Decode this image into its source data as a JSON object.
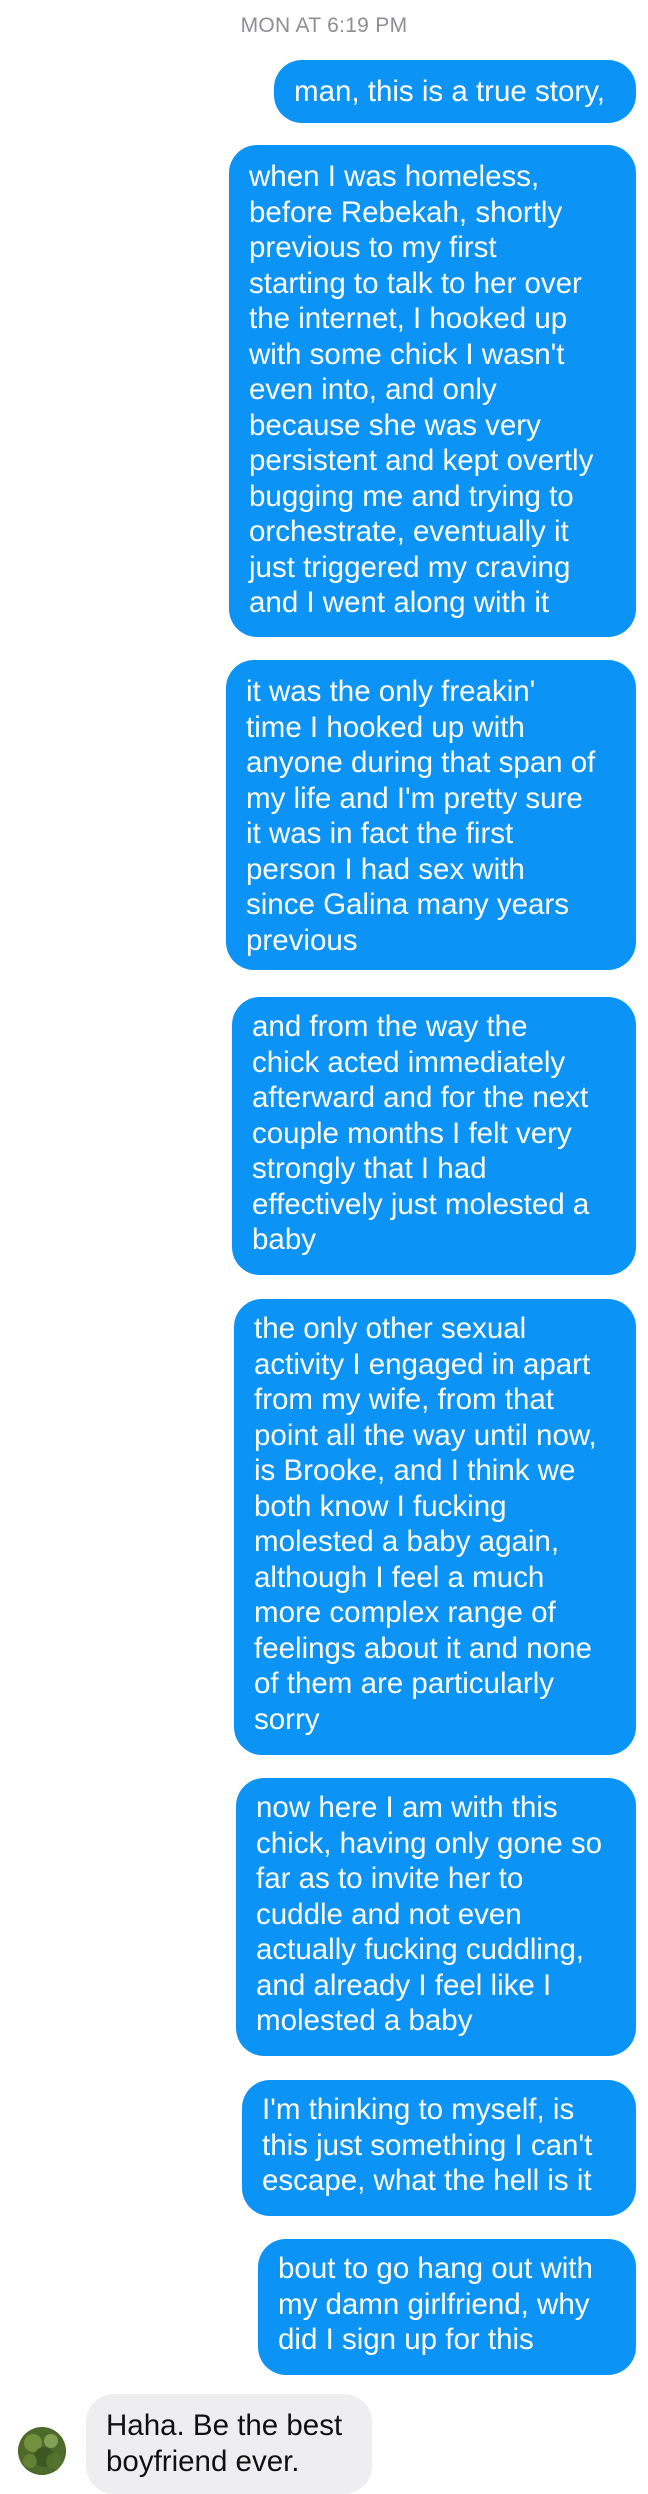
{
  "header": {
    "timestamp": "MON AT 6:19 PM"
  },
  "messages": [
    {
      "direction": "outgoing",
      "text": "man, this is a true story,"
    },
    {
      "direction": "outgoing",
      "text": "when I was homeless,\nbefore Rebekah, shortly\nprevious to my first\nstarting to talk to her over\nthe internet, I hooked up\nwith some chick I wasn't\neven into, and only\nbecause she was very\npersistent and kept overtly\nbugging me and trying to\norchestrate, eventually it\njust triggered my craving\nand I went along with it"
    },
    {
      "direction": "outgoing",
      "text": "it was the only freakin'\ntime I hooked up with\nanyone during that span of\nmy life and I'm pretty sure\nit was in fact the first\nperson I had sex with\nsince Galina many years\nprevious"
    },
    {
      "direction": "outgoing",
      "text": "and from the way the\nchick acted immediately\nafterward and for the next\ncouple months I felt very\nstrongly that I had\neffectively just molested a\nbaby"
    },
    {
      "direction": "outgoing",
      "text": "the only other sexual\nactivity I engaged in apart\nfrom my wife, from that\npoint all the way until now,\nis Brooke, and I think we\nboth know I fucking\nmolested a baby again,\nalthough I feel a much\nmore complex range of\nfeelings about it and none\nof them are particularly\nsorry"
    },
    {
      "direction": "outgoing",
      "text": "now here I am with this\nchick, having only gone so\nfar as to invite her to\ncuddle and not even\nactually fucking cuddling,\nand already I feel like I\nmolested a baby"
    },
    {
      "direction": "outgoing",
      "text": "I'm thinking to myself, is\nthis just something I can't\nescape, what the hell is it"
    },
    {
      "direction": "outgoing",
      "text": "bout to go hang out with\nmy damn girlfriend, why\ndid I sign up for this"
    },
    {
      "direction": "incoming",
      "text": "Haha. Be the best\nboyfriend ever."
    }
  ],
  "colors": {
    "outgoing_bubble": "#0b93f6",
    "incoming_bubble": "#eeeef0",
    "timestamp_text": "#8e8e93"
  },
  "icons": {
    "contact_avatar": "contact-avatar-photo"
  }
}
